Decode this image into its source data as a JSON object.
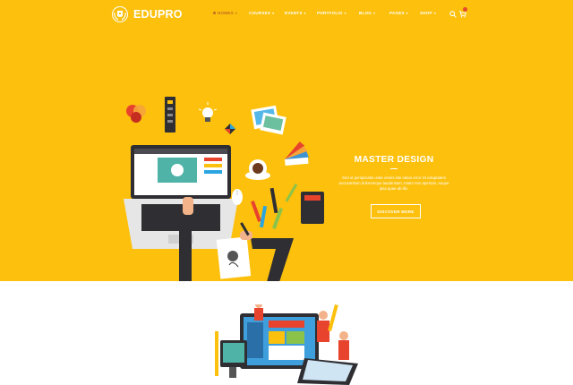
{
  "brand": {
    "name": "EDUPRO"
  },
  "nav": {
    "items": [
      {
        "label": "HOMES",
        "active": true
      },
      {
        "label": "COURSES",
        "active": false
      },
      {
        "label": "EVENTS",
        "active": false
      },
      {
        "label": "PORTFOLIO",
        "active": false
      },
      {
        "label": "BLOG",
        "active": false
      },
      {
        "label": "PAGES",
        "active": false
      },
      {
        "label": "SHOP",
        "active": false
      }
    ],
    "search_icon": "search-icon",
    "cart_icon": "cart-icon"
  },
  "hero": {
    "title": "MASTER DESIGN",
    "description": "Sed ut perspiciatis unde omnis iste natus error sit voluptatem accusantium doloremque laudantium, totam rem aperiam, eaque ipsa quae ab illo.",
    "button_label": "DISCOVER MORE"
  },
  "colors": {
    "hero_background": "#fcc00d",
    "active_nav": "#c36a22",
    "text_light": "#ffffff",
    "body_background": "#ffffff"
  }
}
